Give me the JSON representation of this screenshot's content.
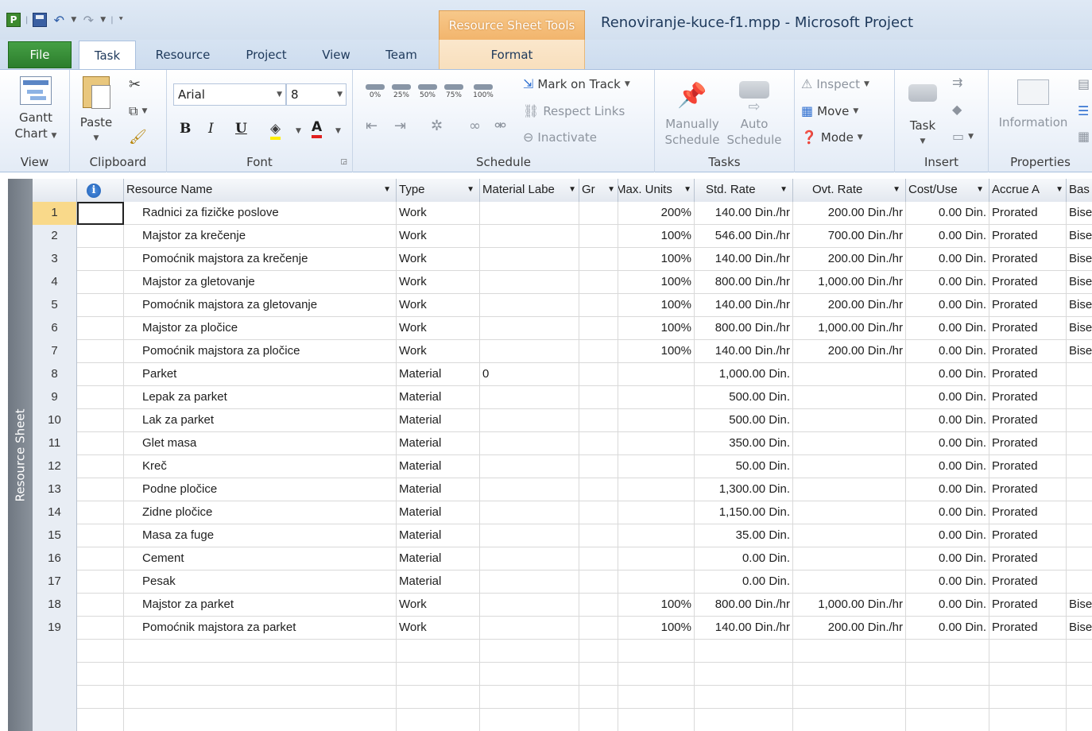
{
  "window": {
    "title": "Renoviranje-kuce-f1.mpp  -  Microsoft Project",
    "context_tab": "Resource Sheet Tools",
    "app_icon": "P"
  },
  "tabs": {
    "file": "File",
    "task": "Task",
    "resource": "Resource",
    "project": "Project",
    "view": "View",
    "team": "Team",
    "format": "Format"
  },
  "ribbon": {
    "view": {
      "gantt_line1": "Gantt",
      "gantt_line2": "Chart",
      "label": "View"
    },
    "clipboard": {
      "paste": "Paste",
      "label": "Clipboard"
    },
    "font": {
      "family": "Arial",
      "size": "8",
      "bold": "B",
      "italic": "I",
      "underline": "U",
      "font_color": "A",
      "label": "Font"
    },
    "schedule": {
      "pct": [
        "0%",
        "25%",
        "50%",
        "75%",
        "100%"
      ],
      "mark_on_track": "Mark on Track",
      "respect_links": "Respect Links",
      "inactivate": "Inactivate",
      "label": "Schedule"
    },
    "tasks": {
      "manually_l1": "Manually",
      "manually_l2": "Schedule",
      "auto_l1": "Auto",
      "auto_l2": "Schedule",
      "inspect": "Inspect",
      "move": "Move",
      "mode": "Mode",
      "label": "Tasks"
    },
    "insert": {
      "task": "Task",
      "label": "Insert"
    },
    "properties": {
      "information": "Information",
      "label": "Properties"
    }
  },
  "sheet": {
    "view_bar": "Resource Sheet",
    "columns": [
      "Resource Name",
      "Type",
      "Material Labe",
      "Gr",
      "Max. Units",
      "Std. Rate",
      "Ovt. Rate",
      "Cost/Use",
      "Accrue A",
      "Bas"
    ],
    "rows": [
      {
        "id": "1",
        "name": "Radnici za fizičke poslove",
        "type": "Work",
        "material": "",
        "group": "",
        "max": "200%",
        "std": "140.00 Din./hr",
        "ovt": "200.00 Din./hr",
        "cost": "0.00 Din.",
        "accrue": "Prorated",
        "base": "Bise"
      },
      {
        "id": "2",
        "name": "Majstor za krečenje",
        "type": "Work",
        "material": "",
        "group": "",
        "max": "100%",
        "std": "546.00 Din./hr",
        "ovt": "700.00 Din./hr",
        "cost": "0.00 Din.",
        "accrue": "Prorated",
        "base": "Bise"
      },
      {
        "id": "3",
        "name": "Pomoćnik majstora za krečenje",
        "type": "Work",
        "material": "",
        "group": "",
        "max": "100%",
        "std": "140.00 Din./hr",
        "ovt": "200.00 Din./hr",
        "cost": "0.00 Din.",
        "accrue": "Prorated",
        "base": "Bise"
      },
      {
        "id": "4",
        "name": "Majstor za gletovanje",
        "type": "Work",
        "material": "",
        "group": "",
        "max": "100%",
        "std": "800.00 Din./hr",
        "ovt": "1,000.00 Din./hr",
        "cost": "0.00 Din.",
        "accrue": "Prorated",
        "base": "Bise"
      },
      {
        "id": "5",
        "name": "Pomoćnik majstora za gletovanje",
        "type": "Work",
        "material": "",
        "group": "",
        "max": "100%",
        "std": "140.00 Din./hr",
        "ovt": "200.00 Din./hr",
        "cost": "0.00 Din.",
        "accrue": "Prorated",
        "base": "Bise"
      },
      {
        "id": "6",
        "name": "Majstor za pločice",
        "type": "Work",
        "material": "",
        "group": "",
        "max": "100%",
        "std": "800.00 Din./hr",
        "ovt": "1,000.00 Din./hr",
        "cost": "0.00 Din.",
        "accrue": "Prorated",
        "base": "Bise"
      },
      {
        "id": "7",
        "name": "Pomoćnik majstora za pločice",
        "type": "Work",
        "material": "",
        "group": "",
        "max": "100%",
        "std": "140.00 Din./hr",
        "ovt": "200.00 Din./hr",
        "cost": "0.00 Din.",
        "accrue": "Prorated",
        "base": "Bise"
      },
      {
        "id": "8",
        "name": "Parket",
        "type": "Material",
        "material": "0",
        "group": "",
        "max": "",
        "std": "1,000.00 Din.",
        "ovt": "",
        "cost": "0.00 Din.",
        "accrue": "Prorated",
        "base": ""
      },
      {
        "id": "9",
        "name": "Lepak za parket",
        "type": "Material",
        "material": "",
        "group": "",
        "max": "",
        "std": "500.00 Din.",
        "ovt": "",
        "cost": "0.00 Din.",
        "accrue": "Prorated",
        "base": ""
      },
      {
        "id": "10",
        "name": "Lak za parket",
        "type": "Material",
        "material": "",
        "group": "",
        "max": "",
        "std": "500.00 Din.",
        "ovt": "",
        "cost": "0.00 Din.",
        "accrue": "Prorated",
        "base": ""
      },
      {
        "id": "11",
        "name": "Glet masa",
        "type": "Material",
        "material": "",
        "group": "",
        "max": "",
        "std": "350.00 Din.",
        "ovt": "",
        "cost": "0.00 Din.",
        "accrue": "Prorated",
        "base": ""
      },
      {
        "id": "12",
        "name": "Kreč",
        "type": "Material",
        "material": "",
        "group": "",
        "max": "",
        "std": "50.00 Din.",
        "ovt": "",
        "cost": "0.00 Din.",
        "accrue": "Prorated",
        "base": ""
      },
      {
        "id": "13",
        "name": "Podne pločice",
        "type": "Material",
        "material": "",
        "group": "",
        "max": "",
        "std": "1,300.00 Din.",
        "ovt": "",
        "cost": "0.00 Din.",
        "accrue": "Prorated",
        "base": ""
      },
      {
        "id": "14",
        "name": "Zidne pločice",
        "type": "Material",
        "material": "",
        "group": "",
        "max": "",
        "std": "1,150.00 Din.",
        "ovt": "",
        "cost": "0.00 Din.",
        "accrue": "Prorated",
        "base": ""
      },
      {
        "id": "15",
        "name": "Masa za fuge",
        "type": "Material",
        "material": "",
        "group": "",
        "max": "",
        "std": "35.00 Din.",
        "ovt": "",
        "cost": "0.00 Din.",
        "accrue": "Prorated",
        "base": ""
      },
      {
        "id": "16",
        "name": "Cement",
        "type": "Material",
        "material": "",
        "group": "",
        "max": "",
        "std": "0.00 Din.",
        "ovt": "",
        "cost": "0.00 Din.",
        "accrue": "Prorated",
        "base": ""
      },
      {
        "id": "17",
        "name": "Pesak",
        "type": "Material",
        "material": "",
        "group": "",
        "max": "",
        "std": "0.00 Din.",
        "ovt": "",
        "cost": "0.00 Din.",
        "accrue": "Prorated",
        "base": ""
      },
      {
        "id": "18",
        "name": "Majstor za parket",
        "type": "Work",
        "material": "",
        "group": "",
        "max": "100%",
        "std": "800.00 Din./hr",
        "ovt": "1,000.00 Din./hr",
        "cost": "0.00 Din.",
        "accrue": "Prorated",
        "base": "Bise"
      },
      {
        "id": "19",
        "name": "Pomoćnik majstora za parket",
        "type": "Work",
        "material": "",
        "group": "",
        "max": "100%",
        "std": "140.00 Din./hr",
        "ovt": "200.00 Din./hr",
        "cost": "0.00 Din.",
        "accrue": "Prorated",
        "base": "Bise"
      }
    ]
  }
}
